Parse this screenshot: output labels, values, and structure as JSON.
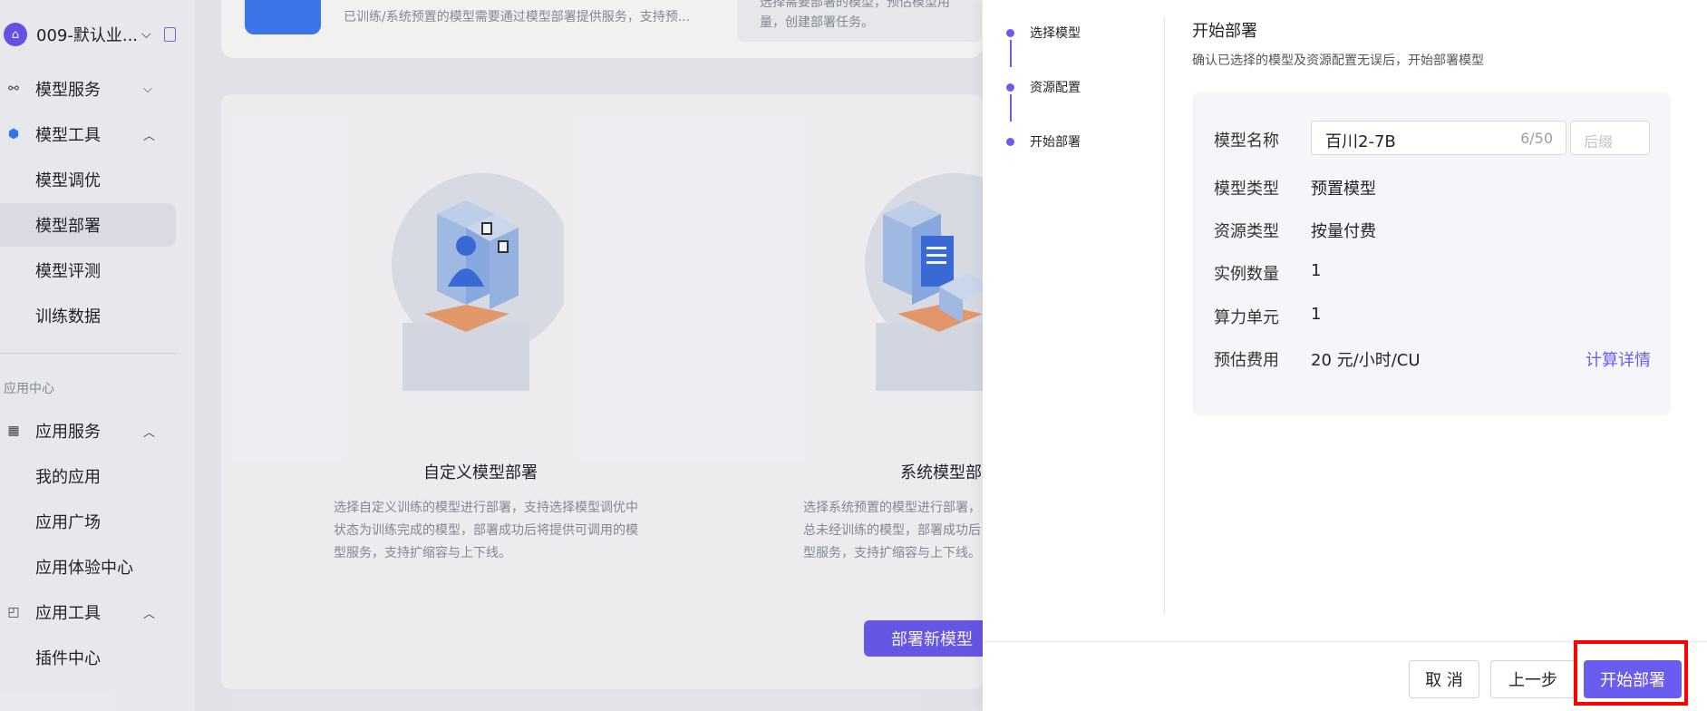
{
  "sidebar": {
    "workspace_name": "009-默认业...",
    "items": [
      {
        "label": "模型服务",
        "chevron": "⌵"
      },
      {
        "label": "模型工具",
        "chevron": "︿"
      },
      {
        "label": "应用服务",
        "chevron": "︿"
      },
      {
        "label": "应用工具",
        "chevron": "︿"
      }
    ],
    "sub_items": [
      "模型调优",
      "模型部署",
      "模型评测",
      "训练数据",
      "我的应用",
      "应用广场",
      "应用体验中心",
      "插件中心"
    ],
    "section_title": "应用中心"
  },
  "main": {
    "top_text": "已训练/系统预置的模型需要通过模型部署提供服务，支持预...",
    "top_box_text": "选择需要部署的模型，预估模型用量，创建部署任务。",
    "cards": [
      {
        "title": "自定义模型部署",
        "desc": "选择自定义训练的模型进行部署，支持选择模型调优中状态为训练完成的模型，部署成功后将提供可调用的模型服务，支持扩缩容与上下线。"
      },
      {
        "title": "系统模型部",
        "desc": "选择系统预置的模型进行部署，总未经训练的模型，部署成功后型服务，支持扩缩容与上下线。"
      }
    ],
    "new_deploy_button": "部署新模型"
  },
  "drawer": {
    "steps": [
      "选择模型",
      "资源配置",
      "开始部署"
    ],
    "title": "开始部署",
    "subtitle": "确认已选择的模型及资源配置无误后，开始部署模型",
    "fields": {
      "model_name_label": "模型名称",
      "model_name_value": "百川2-7B",
      "model_name_count": "6/50",
      "suffix_placeholder": "后缀",
      "model_type_label": "模型类型",
      "model_type_value": "预置模型",
      "resource_type_label": "资源类型",
      "resource_type_value": "按量付费",
      "instance_count_label": "实例数量",
      "instance_count_value": "1",
      "compute_unit_label": "算力单元",
      "compute_unit_value": "1",
      "cost_label": "预估费用",
      "cost_value": "20 元/小时/CU",
      "calc_detail_link": "计算详情"
    },
    "buttons": {
      "cancel": "取 消",
      "prev": "上一步",
      "start": "开始部署"
    }
  },
  "colors": {
    "accent": "#6b5cf0",
    "highlight": "#ff0000"
  }
}
